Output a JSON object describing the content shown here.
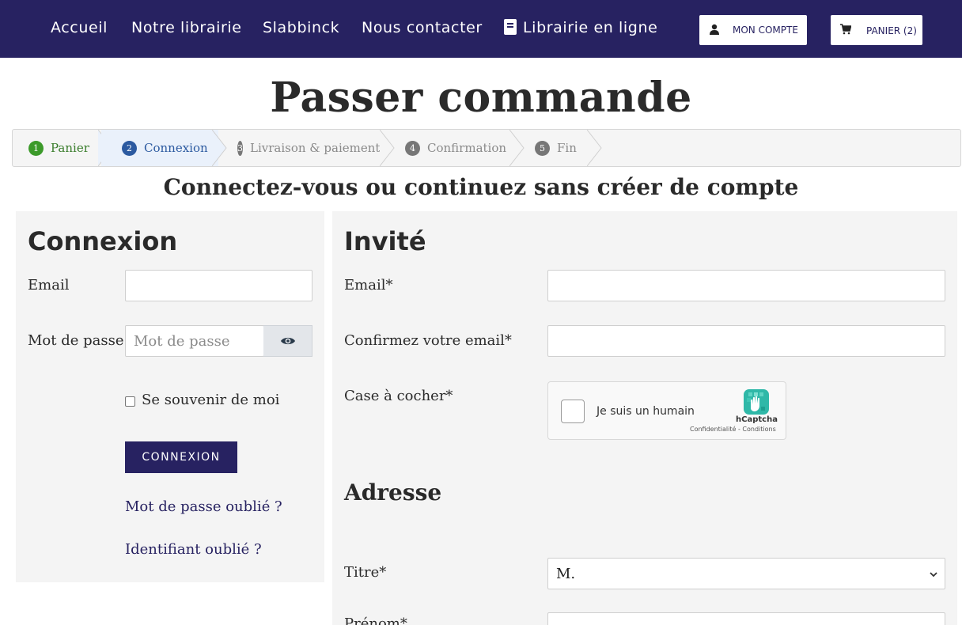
{
  "nav": {
    "items": [
      "Accueil",
      "Notre librairie",
      "Slabbinck",
      "Nous contacter",
      "Librairie en ligne"
    ],
    "account_label": "MON COMPTE",
    "cart_label": "PANIER (2)"
  },
  "page": {
    "title": "Passer commande",
    "subtitle": "Connectez-vous ou continuez sans créer de compte"
  },
  "steps": [
    {
      "num": "1",
      "label": "Panier",
      "state": "done"
    },
    {
      "num": "2",
      "label": "Connexion",
      "state": "active"
    },
    {
      "num": "3",
      "label": "Livraison & paiement",
      "state": "todo"
    },
    {
      "num": "4",
      "label": "Confirmation",
      "state": "todo"
    },
    {
      "num": "5",
      "label": "Fin",
      "state": "todo"
    }
  ],
  "login": {
    "heading": "Connexion",
    "email_label": "Email",
    "email_value": "",
    "password_label": "Mot de passe",
    "password_placeholder": "Mot de passe",
    "remember_label": "Se souvenir de moi",
    "submit_label": "CONNEXION",
    "forgot_password": "Mot de passe oublié ?",
    "forgot_username": "Identifiant oublié ?"
  },
  "guest": {
    "heading": "Invité",
    "email_label": "Email*",
    "confirm_email_label": "Confirmez votre email*",
    "checkbox_label": "Case à cocher*",
    "captcha": {
      "text": "Je suis un humain",
      "brand": "hCaptcha",
      "terms": "Confidentialité - Conditions"
    },
    "address_heading": "Adresse",
    "title_label": "Titre*",
    "title_value": "M.",
    "first_name_label": "Prénom*"
  },
  "colors": {
    "nav_bg": "#272261",
    "step_done": "#3c9a2a",
    "step_active": "#2c5aa0",
    "panel_bg": "#f4f4f4"
  }
}
